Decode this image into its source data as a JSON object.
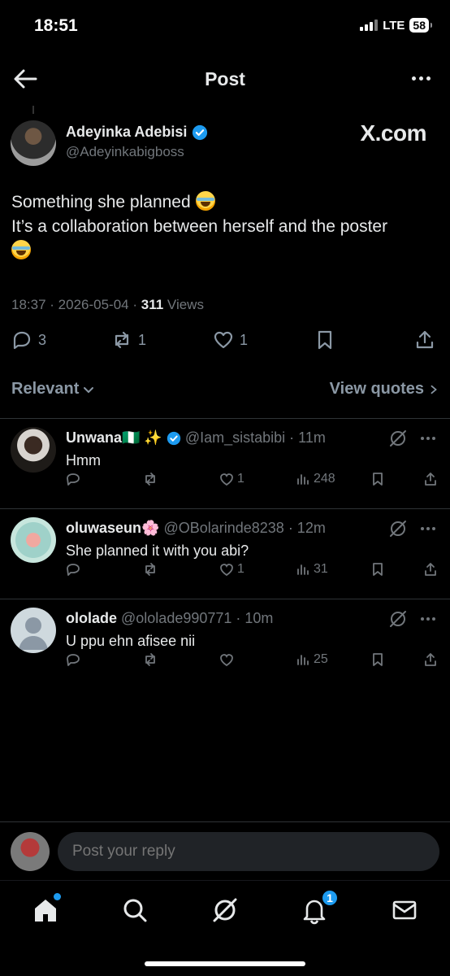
{
  "status": {
    "time": "18:51",
    "network": "LTE",
    "battery": "58"
  },
  "header": {
    "title": "Post"
  },
  "post": {
    "author_name": "Adeyinka Adebisi",
    "author_handle": "@Adeyinkabigboss",
    "brand": "X.com",
    "text_line1": "Something she planned",
    "text_line2": "It’s a collaboration between herself and the poster",
    "time": "18:37",
    "date": "2026-05-04",
    "views_count": "311",
    "views_label": "Views",
    "replies": "3",
    "reposts": "1",
    "likes": "1"
  },
  "sort": {
    "relevant_label": "Relevant",
    "view_quotes_label": "View quotes"
  },
  "replies": [
    {
      "name": "Unwana🇳🇬 ✨",
      "verified": true,
      "handle": "@Iam_sistabibi",
      "time": "· 11m",
      "text": "Hmm",
      "reposts": "",
      "likes": "1",
      "views": "248"
    },
    {
      "name": "oluwaseun🌸",
      "verified": false,
      "handle": "@OBolarinde8238",
      "time": "· 12m",
      "text": "She planned it with you abi?",
      "reposts": "",
      "likes": "1",
      "views": "31"
    },
    {
      "name": "ololade",
      "verified": false,
      "handle": "@ololade990771",
      "time": "· 10m",
      "text": "U ppu ehn afisee nii",
      "reposts": "",
      "likes": "",
      "views": "25"
    }
  ],
  "compose": {
    "placeholder": "Post your reply"
  },
  "tabbar": {
    "notifications_badge": "1"
  },
  "colors": {
    "accent": "#1d9bf0",
    "background": "#000000",
    "muted": "#71767b"
  }
}
